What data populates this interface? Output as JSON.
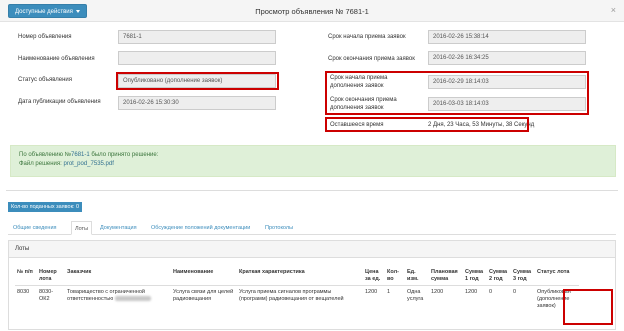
{
  "header": {
    "actions_label": "Доступные действия",
    "title": "Просмотр объявления № 7681-1",
    "close_glyph": "×"
  },
  "form": {
    "notice_number_label": "Номер объявления",
    "notice_number_value": "7681-1",
    "name_label": "Наименование объявления",
    "name_value": "",
    "status_label": "Статус объявления",
    "status_value": "Опубликовано (дополнение заявок)",
    "publish_date_label": "Дата публикации объявления",
    "publish_date_value": "2016-02-26 15:30:30",
    "bid_start_label": "Срок начала приема заявок",
    "bid_start_value": "2016-02-26 15:38:14",
    "bid_end_label": "Срок окончания приема заявок",
    "bid_end_value": "2016-02-26 16:34:25",
    "supp_start_label": "Срок начала приема дополнения заявок",
    "supp_start_value": "2016-02-29 18:14:03",
    "supp_end_label": "Срок окончания приема дополнения заявок",
    "supp_end_value": "2016-03-03 18:14:03",
    "remaining_label": "Оставшееся время",
    "remaining_value": "2 Дня, 23 Часа, 53 Минуты, 38 Секунд"
  },
  "notice": {
    "line1_prefix": "По объявлению №",
    "line1_link": "7681-1",
    "line1_suffix": " было принято решение:",
    "line2_prefix": "Файл решения: ",
    "line2_link": "prot_pod_7535.pdf"
  },
  "bids_badge": "Кол-во поданных заявок: 0",
  "tabs": [
    {
      "label": "Общие сведения"
    },
    {
      "label": "Лоты"
    },
    {
      "label": "Документация"
    },
    {
      "label": "Обсуждение положений документации"
    },
    {
      "label": "Протоколы"
    }
  ],
  "lots": {
    "heading": "Лоты",
    "columns": [
      "№ п/п",
      "Номер лота",
      "Заказчик",
      "Наименование",
      "Краткая характеристика",
      "Цена за ед.",
      "Кол-во",
      "Ед. изм.",
      "Плановая сумма",
      "Сумма 1 год",
      "Сумма 2 год",
      "Сумма 3 год",
      "Статус лота"
    ],
    "rows": [
      {
        "num": "8030",
        "lot_number": "8030-ОК2",
        "customer": "Товарищество с ограниченной ответственностью",
        "name": "Услуга связи для целей радиовещания",
        "description": "Услуга приема сигналов программы (программ) радиовещания от вещателей",
        "price": "1200",
        "qty": "1",
        "unit": "Одна услуга",
        "planned": "1200",
        "sum1": "1200",
        "sum2": "0",
        "sum3": "0",
        "status": "Опубликован (дополнение заявок)"
      }
    ]
  },
  "colors": {
    "primary": "#3c8dbc",
    "highlight": "#cc0000",
    "notice_bg": "#dff0d8"
  }
}
